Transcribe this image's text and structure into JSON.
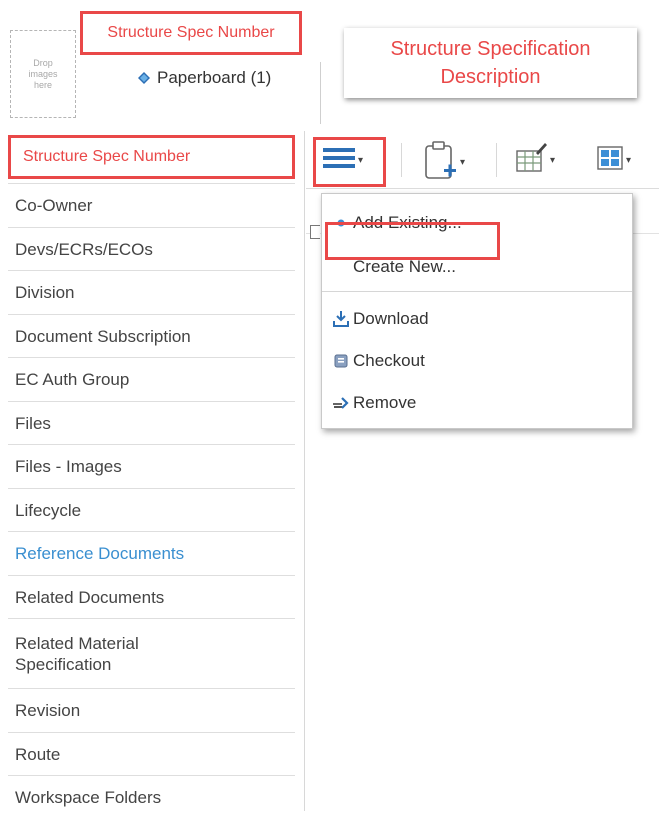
{
  "header": {
    "drop_zone": "Drop\nimages\nhere",
    "spec_number_label": "Structure Spec Number",
    "object_title": "Paperboard (1)",
    "description_label": "Structure Specification Description"
  },
  "nav": {
    "header_label": "Structure Spec Number",
    "items": [
      {
        "label": "Co-Owner"
      },
      {
        "label": "Devs/ECRs/ECOs"
      },
      {
        "label": "Division"
      },
      {
        "label": "Document Subscription"
      },
      {
        "label": "EC Auth Group"
      },
      {
        "label": "Files"
      },
      {
        "label": "Files - Images"
      },
      {
        "label": "Lifecycle"
      },
      {
        "label": "Reference Documents",
        "active": true
      },
      {
        "label": "Related Documents"
      },
      {
        "label": "Related Material\nSpecification"
      },
      {
        "label": "Revision"
      },
      {
        "label": "Route"
      },
      {
        "label": "Workspace Folders"
      }
    ],
    "active_color": "#3a8fd0"
  },
  "toolbar": {
    "buttons": [
      {
        "icon": "hamburger-menu-icon"
      },
      {
        "icon": "new-document-icon"
      },
      {
        "icon": "edit-table-icon"
      },
      {
        "icon": "table-view-icon"
      }
    ]
  },
  "dropdown": {
    "items": [
      {
        "label": "Add Existing...",
        "icon": "bullet-icon"
      },
      {
        "label": "Create New...",
        "icon": ""
      },
      {
        "label": "Download",
        "icon": "download-icon"
      },
      {
        "label": "Checkout",
        "icon": "checkout-icon"
      },
      {
        "label": "Remove",
        "icon": "remove-icon"
      }
    ]
  },
  "colors": {
    "annotation_red": "#e94848",
    "accent_blue": "#2c6fb5"
  }
}
